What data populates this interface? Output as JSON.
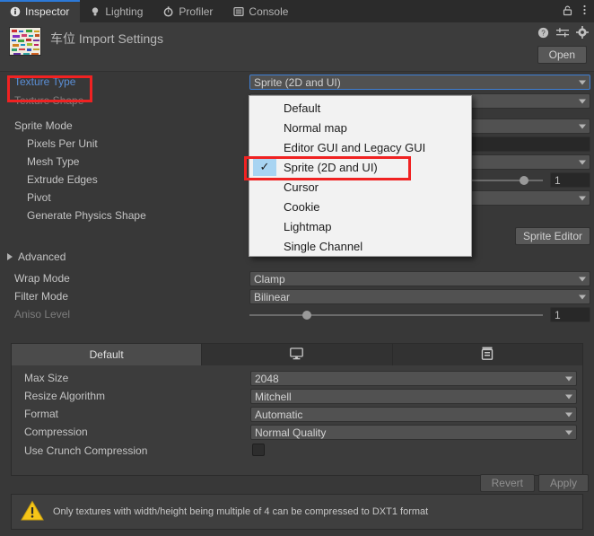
{
  "window": {
    "tabs": [
      {
        "label": "Inspector",
        "icon": "info-icon",
        "active": true
      },
      {
        "label": "Lighting",
        "icon": "lightbulb-icon",
        "active": false
      },
      {
        "label": "Profiler",
        "icon": "stopwatch-icon",
        "active": false
      },
      {
        "label": "Console",
        "icon": "console-icon",
        "active": false
      }
    ],
    "lock_icon": "lock-icon",
    "menu_icon": "kebab-menu-icon"
  },
  "header": {
    "title": "车位 Import Settings",
    "help_icon": "help-icon",
    "preset_icon": "preset-icon",
    "settings_icon": "gear-icon",
    "open_label": "Open"
  },
  "properties": {
    "texture_type": {
      "label": "Texture Type",
      "value": "Sprite (2D and UI)"
    },
    "texture_shape": {
      "label": "Texture Shape",
      "value": ""
    },
    "sprite_mode": {
      "label": "Sprite Mode",
      "value": ""
    },
    "pixels_per_unit": {
      "label": "Pixels Per Unit",
      "value": ""
    },
    "mesh_type": {
      "label": "Mesh Type",
      "value": ""
    },
    "extrude_edges": {
      "label": "Extrude Edges",
      "value": "1"
    },
    "pivot": {
      "label": "Pivot",
      "value": ""
    },
    "generate_physics_shape": {
      "label": "Generate Physics Shape",
      "value": ""
    },
    "sprite_editor_label": "Sprite Editor",
    "advanced_label": "Advanced",
    "wrap_mode": {
      "label": "Wrap Mode",
      "value": "Clamp"
    },
    "filter_mode": {
      "label": "Filter Mode",
      "value": "Bilinear"
    },
    "aniso_level": {
      "label": "Aniso Level",
      "value": "1"
    }
  },
  "platform_tabs": [
    {
      "label": "Default",
      "icon": "",
      "active": true
    },
    {
      "label": "",
      "icon": "standalone-monitor-icon",
      "active": false
    },
    {
      "label": "",
      "icon": "webgl-icon",
      "active": false
    }
  ],
  "platform_settings": {
    "max_size": {
      "label": "Max Size",
      "value": "2048"
    },
    "resize_algorithm": {
      "label": "Resize Algorithm",
      "value": "Mitchell"
    },
    "format": {
      "label": "Format",
      "value": "Automatic"
    },
    "compression": {
      "label": "Compression",
      "value": "Normal Quality"
    },
    "use_crunch_compression": {
      "label": "Use Crunch Compression",
      "checked": false
    }
  },
  "dropdown": {
    "open": true,
    "items": [
      {
        "label": "Default",
        "selected": false
      },
      {
        "label": "Normal map",
        "selected": false
      },
      {
        "label": "Editor GUI and Legacy GUI",
        "selected": false
      },
      {
        "label": "Sprite (2D and UI)",
        "selected": true
      },
      {
        "label": "Cursor",
        "selected": false
      },
      {
        "label": "Cookie",
        "selected": false
      },
      {
        "label": "Lightmap",
        "selected": false
      },
      {
        "label": "Single Channel",
        "selected": false
      }
    ],
    "check_glyph": "✓"
  },
  "footer": {
    "revert_label": "Revert",
    "apply_label": "Apply",
    "warning_icon": "warning-triangle-icon",
    "warning_text": "Only textures with width/height being multiple of 4 can be compressed to DXT1 format"
  },
  "colors": {
    "accent_blue": "#5b8fd6",
    "annotation_red": "#f02222",
    "warning_yellow": "#f5c518",
    "panel_bg": "#383838",
    "field_bg": "#515151",
    "popup_bg": "#f2f2f2",
    "selection_blue": "#a8d4f2"
  }
}
